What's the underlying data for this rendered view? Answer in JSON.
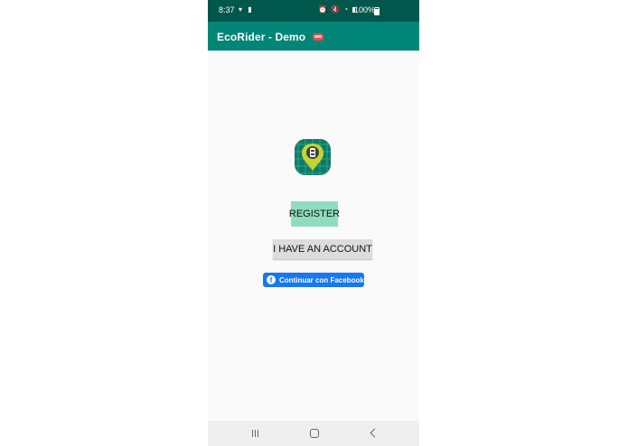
{
  "status_bar": {
    "time": "8:37",
    "battery": "100%"
  },
  "app_bar": {
    "title": "EcoRider - Demo"
  },
  "main": {
    "register_label": "REGISTER",
    "account_label": "I HAVE AN ACCOUNT",
    "facebook_label": "Continuar con Facebook"
  },
  "icons": {
    "title": "car-emoji-icon",
    "logo": "map-pin-logo-icon",
    "facebook": "facebook-icon"
  },
  "colors": {
    "status_bar": "#00574b",
    "app_bar": "#008577",
    "register_button": "#8fdcc0",
    "facebook_button": "#1877f2"
  }
}
